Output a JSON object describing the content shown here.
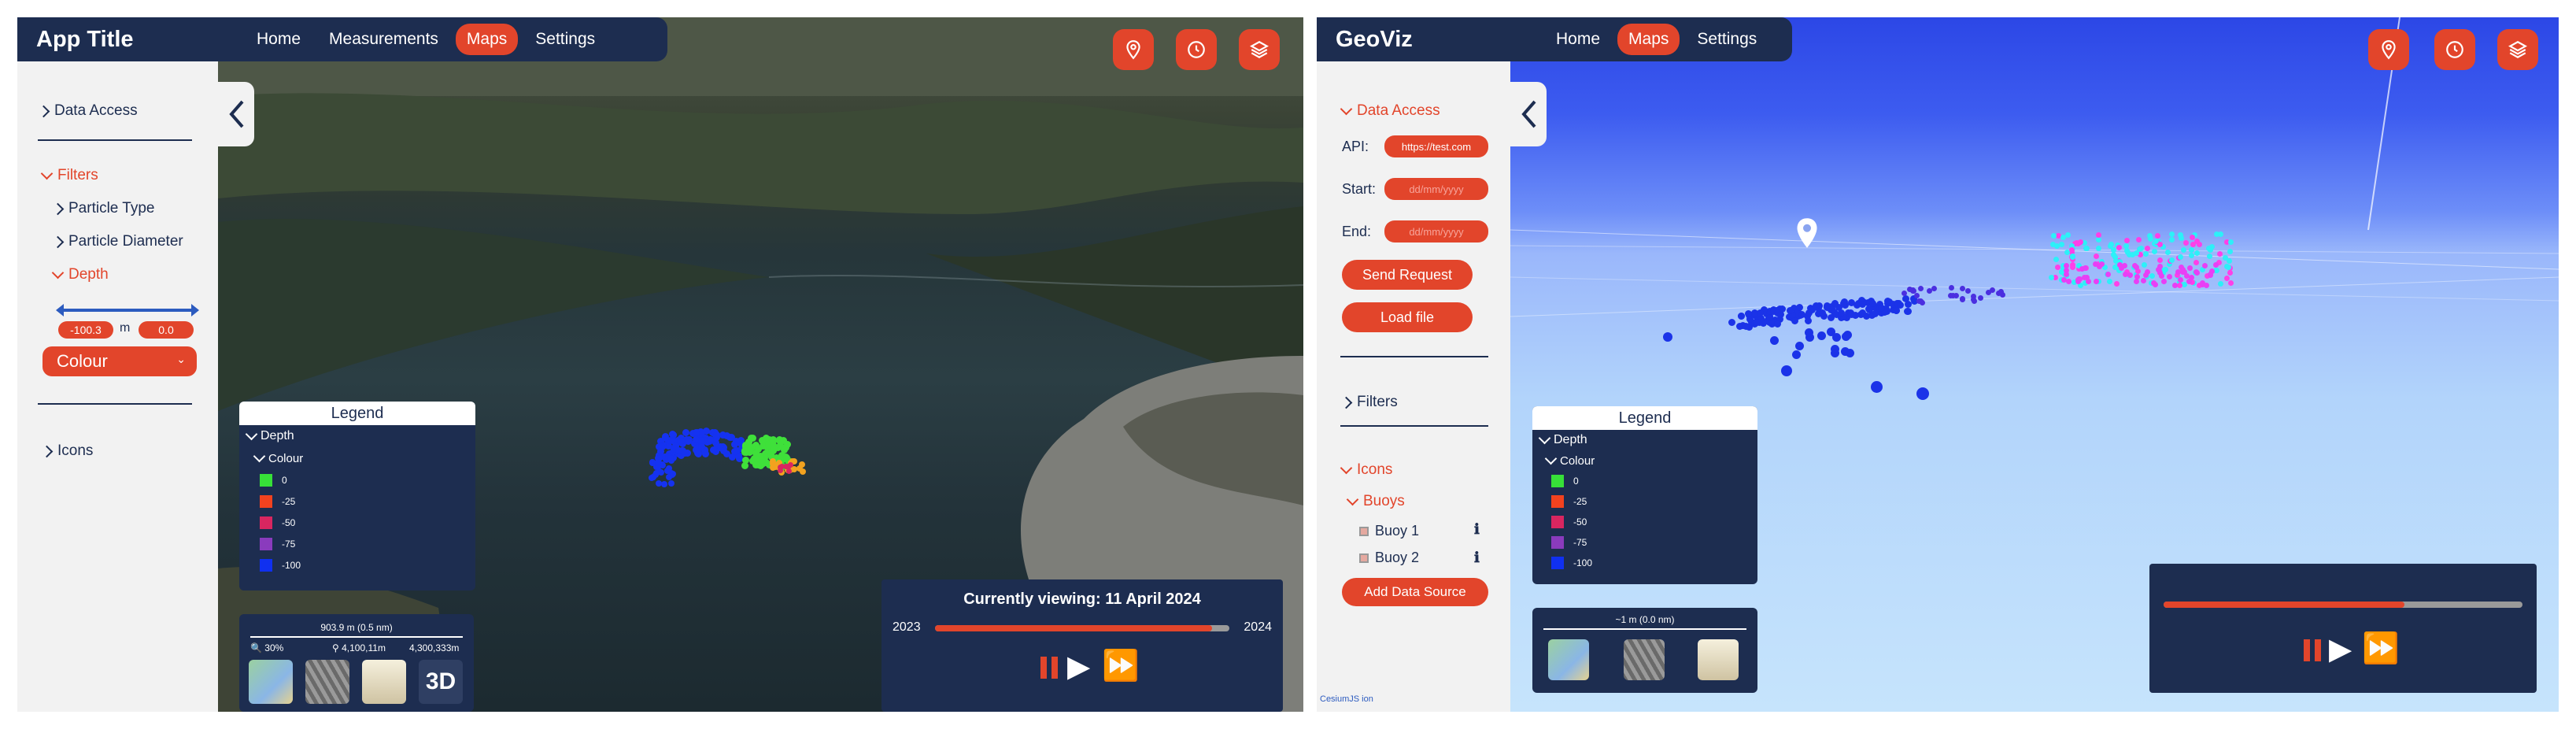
{
  "left": {
    "app_title": "App Title",
    "nav": [
      "Home",
      "Measurements",
      "Maps",
      "Settings"
    ],
    "active_nav": "Maps",
    "tools": [
      "map-pin-icon",
      "clock-icon",
      "layers-icon"
    ],
    "sidebar": {
      "data_access": "Data Access",
      "filters": "Filters",
      "particle_type": "Particle Type",
      "particle_diameter": "Particle Diameter",
      "depth": "Depth",
      "depth_min": "-100.3",
      "depth_unit": "m",
      "depth_max": "0.0",
      "colour_select": "Colour",
      "icons": "Icons"
    },
    "legend": {
      "title": "Legend",
      "depth": "Depth",
      "colour": "Colour",
      "items": [
        {
          "label": "0",
          "color": "#37e038"
        },
        {
          "label": "-25",
          "color": "#f2421f"
        },
        {
          "label": "-50",
          "color": "#d82660"
        },
        {
          "label": "-75",
          "color": "#8a3bbd"
        },
        {
          "label": "-100",
          "color": "#1030f0"
        }
      ]
    },
    "scale": {
      "distance": "903.9 m (0.5 nm)",
      "zoom": "30%",
      "coord1": "4,100,11m",
      "coord2": "4,300,333m",
      "mode": "3D"
    },
    "timeline": {
      "viewing": "Currently viewing: 11 April 2024",
      "start": "2023",
      "end": "2024",
      "progress": 0.94
    }
  },
  "right": {
    "app_title": "GeoViz",
    "nav": [
      "Home",
      "Maps",
      "Settings"
    ],
    "active_nav": "Maps",
    "tools": [
      "map-pin-icon",
      "clock-icon",
      "layers-icon"
    ],
    "sidebar": {
      "data_access": "Data Access",
      "api_label": "API:",
      "api_value": "https://test.com",
      "start_label": "Start:",
      "start_placeholder": "dd/mm/yyyy",
      "end_label": "End:",
      "end_placeholder": "dd/mm/yyyy",
      "send_request": "Send Request",
      "load_file": "Load file",
      "filters": "Filters",
      "icons": "Icons",
      "buoys": "Buoys",
      "buoy1": "Buoy 1",
      "buoy2": "Buoy 2",
      "add_source": "Add Data Source"
    },
    "legend": {
      "title": "Legend",
      "depth": "Depth",
      "colour": "Colour",
      "items": [
        {
          "label": "0",
          "color": "#37e038"
        },
        {
          "label": "-25",
          "color": "#f2421f"
        },
        {
          "label": "-50",
          "color": "#d82660"
        },
        {
          "label": "-75",
          "color": "#8a3bbd"
        },
        {
          "label": "-100",
          "color": "#1030f0"
        }
      ]
    },
    "scale": {
      "distance": "~1 m (0.0 nm)"
    },
    "timeline": {
      "progress": 0.67
    },
    "credits": "CesiumJS ion"
  }
}
